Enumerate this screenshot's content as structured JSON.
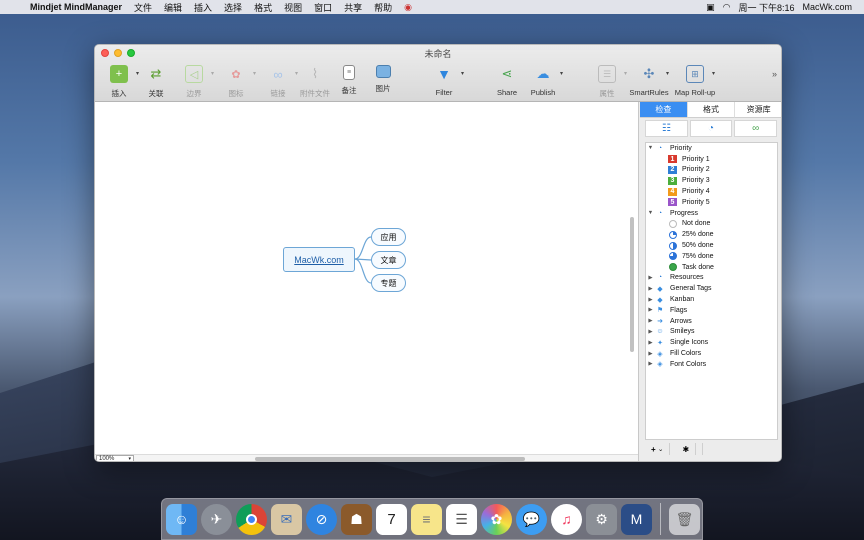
{
  "menubar": {
    "app_name": "Mindjet MindManager",
    "items": [
      "文件",
      "编辑",
      "插入",
      "选择",
      "格式",
      "视图",
      "窗口",
      "共享",
      "帮助"
    ],
    "clock": "周一 下午8:16",
    "site": "MacWk.com"
  },
  "window": {
    "title": "未命名"
  },
  "toolbar": {
    "insert": "插入",
    "relationship": "关联",
    "boundary": "边界",
    "icon": "图标",
    "link": "链接",
    "attachment": "附件文件",
    "notes": "备注",
    "image": "图片",
    "filter": "Filter",
    "share": "Share",
    "publish": "Publish",
    "properties": "属性",
    "smartrules": "SmartRules",
    "maprollup": "Map Roll-up"
  },
  "map": {
    "central": "MacWk.com",
    "subtopics": [
      "应用",
      "文章",
      "专题"
    ]
  },
  "canvas": {
    "zoom": "100%"
  },
  "panel": {
    "tabs": [
      "检查",
      "格式",
      "资源库"
    ],
    "groups": {
      "priority": {
        "label": "Priority",
        "items": [
          "Priority 1",
          "Priority 2",
          "Priority 3",
          "Priority 4",
          "Priority 5"
        ],
        "badges": [
          "1",
          "2",
          "3",
          "4",
          "5"
        ],
        "colors": [
          "#d83a2e",
          "#2f7fd6",
          "#4bae3c",
          "#f29a1b",
          "#9a55c9"
        ]
      },
      "progress": {
        "label": "Progress",
        "items": [
          "Not done",
          "25% done",
          "50% done",
          "75% done",
          "Task done"
        ]
      },
      "collapsed": [
        "Resources",
        "General Tags",
        "Kanban",
        "Flags",
        "Arrows",
        "Smileys",
        "Single Icons",
        "Fill Colors",
        "Font Colors"
      ]
    },
    "footer_add": "+",
    "footer_menu": "⌄",
    "footer_gear": "✱"
  },
  "colors": {
    "accent": "#3a8ef2",
    "topic_border": "#6da6d6"
  }
}
